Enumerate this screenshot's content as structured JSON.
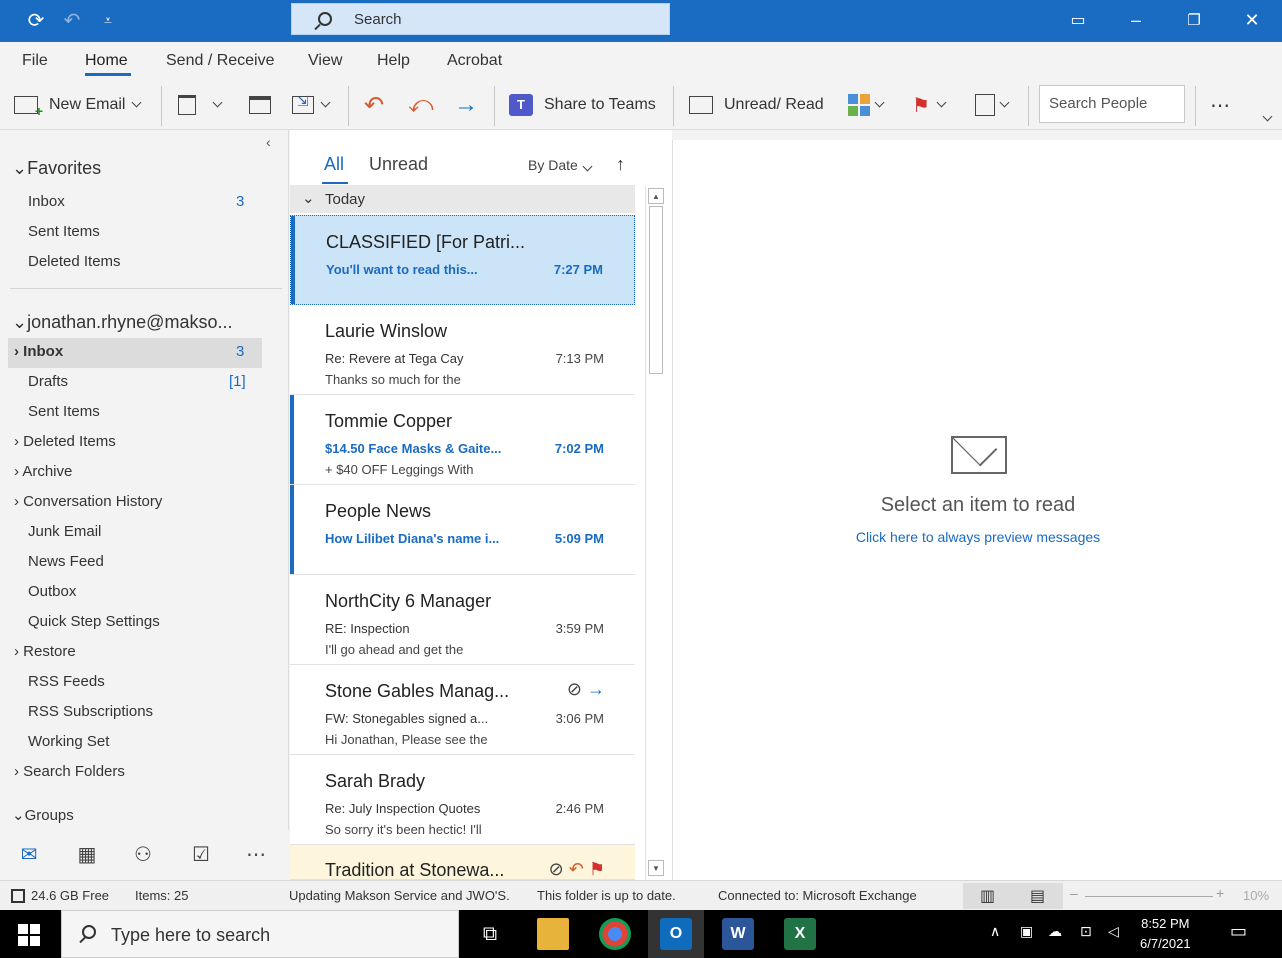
{
  "titlebar": {
    "search_placeholder": "Search"
  },
  "menu": [
    "File",
    "Home",
    "Send / Receive",
    "View",
    "Help",
    "Acrobat"
  ],
  "ribbon": {
    "new_email": "New Email",
    "share_to_teams": "Share to Teams",
    "unread_read": "Unread/ Read",
    "search_people_placeholder": "Search People"
  },
  "folders": {
    "favorites_header": "Favorites",
    "favorites": [
      {
        "label": "Inbox",
        "count": "3"
      },
      {
        "label": "Sent Items",
        "count": ""
      },
      {
        "label": "Deleted Items",
        "count": ""
      }
    ],
    "account_header": "jonathan.rhyne@makso...",
    "account_folders": [
      {
        "label": "Inbox",
        "count": "3"
      },
      {
        "label": "Drafts",
        "count": "[1]"
      },
      {
        "label": "Sent Items",
        "count": ""
      },
      {
        "label": "Deleted Items",
        "count": ""
      },
      {
        "label": "Archive",
        "count": ""
      },
      {
        "label": "Conversation History",
        "count": ""
      },
      {
        "label": "Junk Email",
        "count": ""
      },
      {
        "label": "News Feed",
        "count": ""
      },
      {
        "label": "Outbox",
        "count": ""
      },
      {
        "label": "Quick Step Settings",
        "count": ""
      },
      {
        "label": "Restore",
        "count": ""
      },
      {
        "label": "RSS Feeds",
        "count": ""
      },
      {
        "label": "RSS Subscriptions",
        "count": ""
      },
      {
        "label": "Working Set",
        "count": ""
      },
      {
        "label": "Search Folders",
        "count": ""
      }
    ],
    "groups_header": "Groups"
  },
  "message_list": {
    "tab_all": "All",
    "tab_unread": "Unread",
    "sort": "By Date",
    "group": "Today",
    "messages": [
      {
        "from": "CLASSIFIED [For Patri...",
        "subject": "You'll want to read this...",
        "preview": "",
        "time": "7:27 PM"
      },
      {
        "from": "Laurie Winslow",
        "subject": "Re: Revere at Tega Cay",
        "preview": "Thanks so much for the",
        "time": "7:13 PM"
      },
      {
        "from": "Tommie Copper",
        "subject": "$14.50 Face Masks & Gaite...",
        "preview": "+ $40 OFF Leggings With",
        "time": "7:02 PM"
      },
      {
        "from": "People News",
        "subject": "How Lilibet Diana's name i...",
        "preview": "",
        "time": "5:09 PM"
      },
      {
        "from": "NorthCity 6 Manager",
        "subject": "RE: Inspection",
        "preview": "I'll go ahead and get the",
        "time": "3:59 PM"
      },
      {
        "from": "Stone Gables Manag...",
        "subject": "FW: Stonegables signed a...",
        "preview": "Hi Jonathan,  Please see the",
        "time": "3:06 PM"
      },
      {
        "from": "Sarah Brady",
        "subject": "Re: July Inspection Quotes",
        "preview": "So sorry it's been hectic! I'll",
        "time": "2:46 PM"
      },
      {
        "from": "Tradition at Stonewa...",
        "subject": "",
        "preview": "",
        "time": ""
      }
    ]
  },
  "reading_pane": {
    "title": "Select an item to read",
    "link": "Click here to always preview messages"
  },
  "statusbar": {
    "disk": "24.6 GB Free",
    "items": "Items: 25",
    "updating": "Updating Makson Service and JWO'S.",
    "uptodate": "This folder is up to date.",
    "connected": "Connected to: Microsoft Exchange",
    "zoom": "10%"
  },
  "taskbar": {
    "search_placeholder": "Type here to search",
    "time": "8:52 PM",
    "date": "6/7/2021"
  },
  "colors": {
    "accent": "#1a6bc2",
    "selected_row": "#cce4f7",
    "flagged_row": "#fdf6dc"
  }
}
